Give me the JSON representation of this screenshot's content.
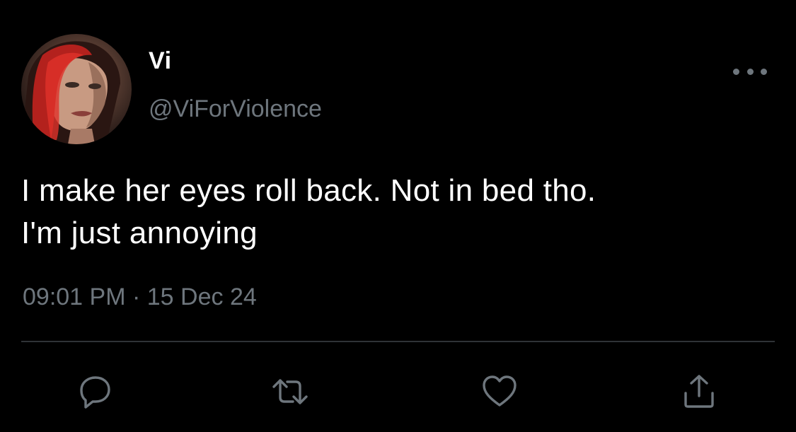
{
  "tweet": {
    "author": {
      "display_name": "Vi",
      "handle": "@ViForViolence",
      "avatar_icon": "profile-avatar"
    },
    "text_lines": [
      "I make her eyes roll back. Not in bed tho.",
      "I'm just annoying"
    ],
    "time": "09:01 PM",
    "separator": "·",
    "date": "15 Dec 24",
    "actions": [
      {
        "name": "reply",
        "icon": "comment-icon"
      },
      {
        "name": "retweet",
        "icon": "retweet-icon"
      },
      {
        "name": "like",
        "icon": "heart-icon"
      },
      {
        "name": "share",
        "icon": "share-icon"
      }
    ]
  },
  "colors": {
    "background": "#000000",
    "text_primary": "#ffffff",
    "text_secondary": "#6e767d",
    "divider": "#2f3336"
  }
}
